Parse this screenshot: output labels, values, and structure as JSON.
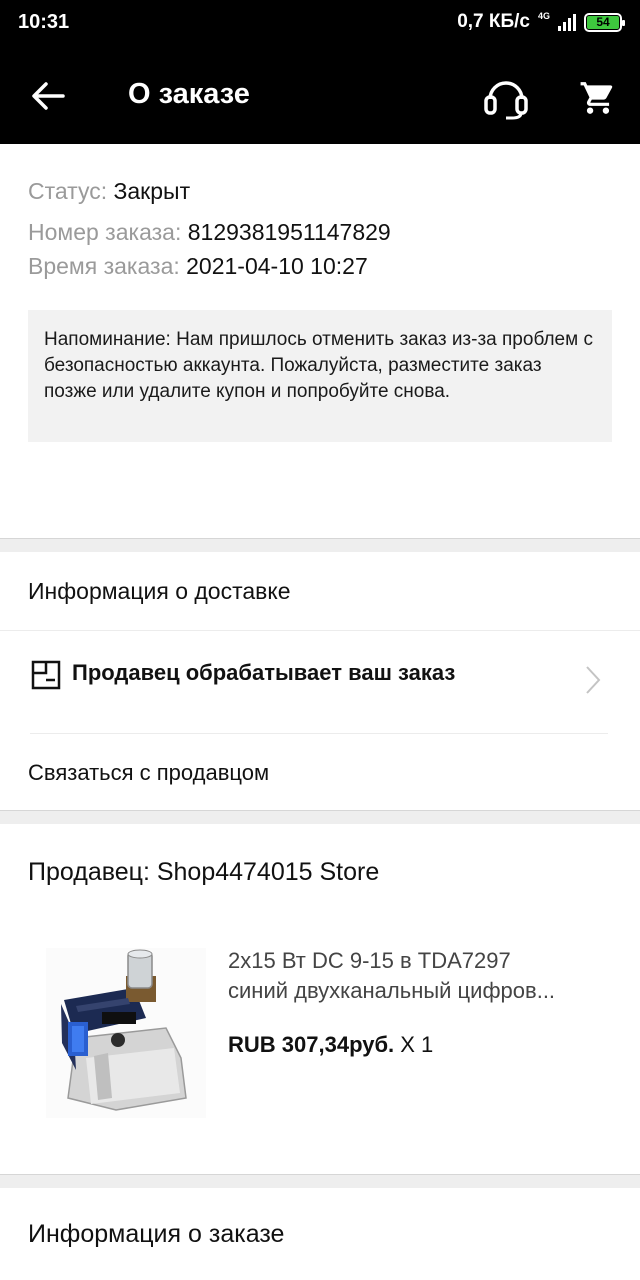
{
  "status_bar": {
    "time": "10:31",
    "net_speed": "0,7 КБ/с",
    "network_type": "4G",
    "battery": "54",
    "battery_color": "#3ec83e"
  },
  "app_bar": {
    "title": "О заказе",
    "back_icon": "arrow-left-icon",
    "support_icon": "headset-icon",
    "cart_icon": "cart-icon"
  },
  "order": {
    "status_label": "Статус:",
    "status_value": "Закрыт",
    "number_label": "Номер заказа:",
    "number_value": "8129381951147829",
    "time_label": "Время заказа:",
    "time_value": "2021-04-10 10:27",
    "reminder": "Напоминание: Нам пришлось отменить заказ из-за проблем с безопасностью аккаунта. Пожалуйста, разместите заказ позже или удалите купон и попробуйте снова."
  },
  "delivery": {
    "title": "Информация о доставке",
    "seller_status": "Продавец обрабатывает ваш заказ",
    "contact_seller": "Связаться с продавцом"
  },
  "seller": {
    "name": "Продавец: Shop4474015 Store",
    "product": {
      "name_line1": "2x15 Вт DC 9-15 в TDA7297",
      "name_line2": "синий двухканальный цифров...",
      "price": "RUB 307,34руб.",
      "quantity": " X 1"
    }
  },
  "order_info": {
    "title": "Информация о заказе"
  }
}
